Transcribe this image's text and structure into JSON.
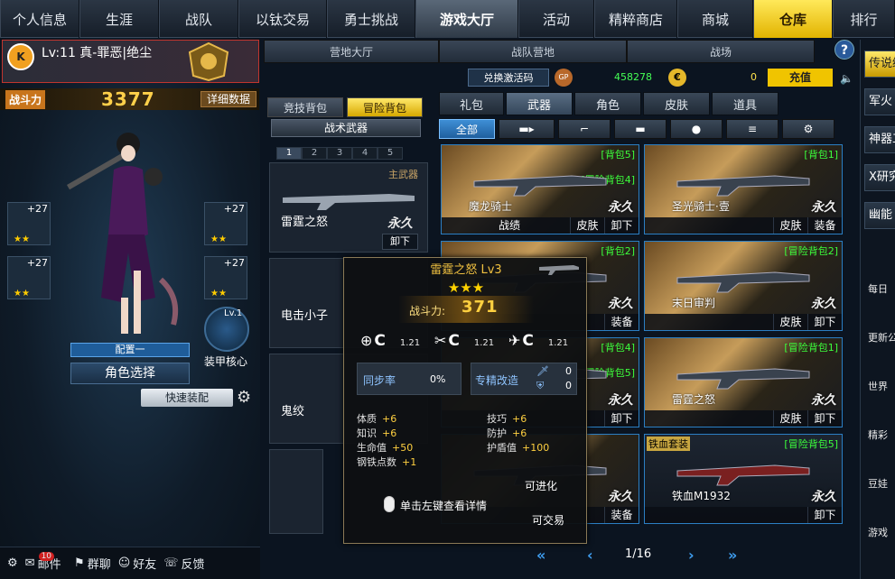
{
  "nav": {
    "tabs": [
      "个人信息",
      "生涯",
      "战队",
      "以钛交易",
      "勇士挑战",
      "游戏大厅",
      "活动",
      "精粹商店",
      "商城",
      "仓库",
      "排行"
    ],
    "active": "游戏大厅",
    "highlight": "仓库"
  },
  "profile": {
    "level_name": "Lv:11 真-罪恶|绝尘"
  },
  "power": {
    "label": "战斗力",
    "value": "3377",
    "detail_btn": "详细数据"
  },
  "equip": {
    "slot1_plus": "+27",
    "slot2_plus": "+27",
    "slot3_plus": "+27",
    "slot4_plus": "+27",
    "core_level": "Lv.1",
    "core_label": "装甲核心"
  },
  "char": {
    "config": "配置一",
    "select": "角色选择",
    "quick": "快速装配"
  },
  "bottombar": {
    "mail": "邮件",
    "mail_badge": "10",
    "group": "群聊",
    "friends": "好友",
    "feedback": "反馈"
  },
  "subtabs": [
    "营地大厅",
    "战队营地",
    "战场"
  ],
  "currency": {
    "redeem": "兑换激活码",
    "gp_icon": "GP",
    "gp": "458278",
    "coin": "0",
    "recharge": "充值"
  },
  "bag": {
    "competitive": "竞技背包",
    "adventure": "冒险背包",
    "tactical": "战术武器",
    "pages": [
      "1",
      "2",
      "3",
      "4",
      "5"
    ],
    "main_weapon": "主武器",
    "item1": "雷霆之怒",
    "item1_forever": "永久",
    "item1_unload": "卸下",
    "item2": "电击小子",
    "item3": "鬼绞"
  },
  "categories": [
    "礼包",
    "武器",
    "角色",
    "皮肤",
    "道具"
  ],
  "active_category": "武器",
  "filters": {
    "all": "全部"
  },
  "cards": [
    {
      "name": "魔龙骑士",
      "tags": [
        "[背包5]",
        "[冒险背包4]"
      ],
      "forever": "永久",
      "btns": [
        "战绩",
        "皮肤",
        "卸下"
      ]
    },
    {
      "name": "圣光骑士·壹",
      "tags": [
        "[背包1]"
      ],
      "forever": "永久",
      "btns": [
        "皮肤",
        "装备"
      ]
    },
    {
      "name": "",
      "tags": [
        "[背包2]"
      ],
      "forever": "永久",
      "btns": [
        "装备"
      ]
    },
    {
      "name": "末日审判",
      "tags": [
        "[冒险背包2]"
      ],
      "forever": "永久",
      "btns": [
        "皮肤",
        "卸下"
      ]
    },
    {
      "name": "",
      "tags": [
        "[背包4]",
        "[冒险背包5]"
      ],
      "forever": "永久",
      "btns": [
        "卸下"
      ]
    },
    {
      "name": "雷霆之怒",
      "tags": [
        "[冒险背包1]"
      ],
      "forever": "永久",
      "btns": [
        "皮肤",
        "卸下"
      ]
    },
    {
      "name": "",
      "tags": [],
      "forever": "永久",
      "btns": [
        "装备"
      ]
    },
    {
      "name": "铁血M1932",
      "tags": [
        "[冒险背包5]"
      ],
      "badge": "铁血套装",
      "forever": "永久",
      "btns": [
        "卸下"
      ]
    }
  ],
  "tooltip": {
    "title": "雷霆之怒 Lv3",
    "stars": "★★★",
    "power_label": "战斗力:",
    "power": "371",
    "grades": [
      {
        "rank": "C",
        "val": "1.21"
      },
      {
        "rank": "C",
        "val": "1.21"
      },
      {
        "rank": "C",
        "val": "1.21"
      }
    ],
    "sync_label": "同步率",
    "sync_val": "0%",
    "refine_label": "专精改造",
    "refine_a": "0",
    "refine_b": "0",
    "stats": [
      {
        "k": "体质",
        "v": "+6"
      },
      {
        "k": "技巧",
        "v": "+6"
      },
      {
        "k": "知识",
        "v": "+6"
      },
      {
        "k": "防护",
        "v": "+6"
      },
      {
        "k": "生命值",
        "v": "+50"
      },
      {
        "k": "护盾值",
        "v": "+100"
      },
      {
        "k": "钢铁点数",
        "v": "+1"
      }
    ],
    "evolve": "可进化",
    "hint": "单击左键查看详情",
    "trade": "可交易"
  },
  "pager": {
    "text": "1/16"
  },
  "right": [
    "传说级",
    "军火",
    "神器工",
    "X研究",
    "幽能"
  ],
  "right_icons": [
    "每日",
    "更新公",
    "世界",
    "精彩",
    "豆娃",
    "游戏"
  ],
  "colors": {
    "accent": "#2b7fc4",
    "gold": "#ffd040",
    "green": "#3cff3c",
    "warehouse": "#f2cd1a"
  }
}
